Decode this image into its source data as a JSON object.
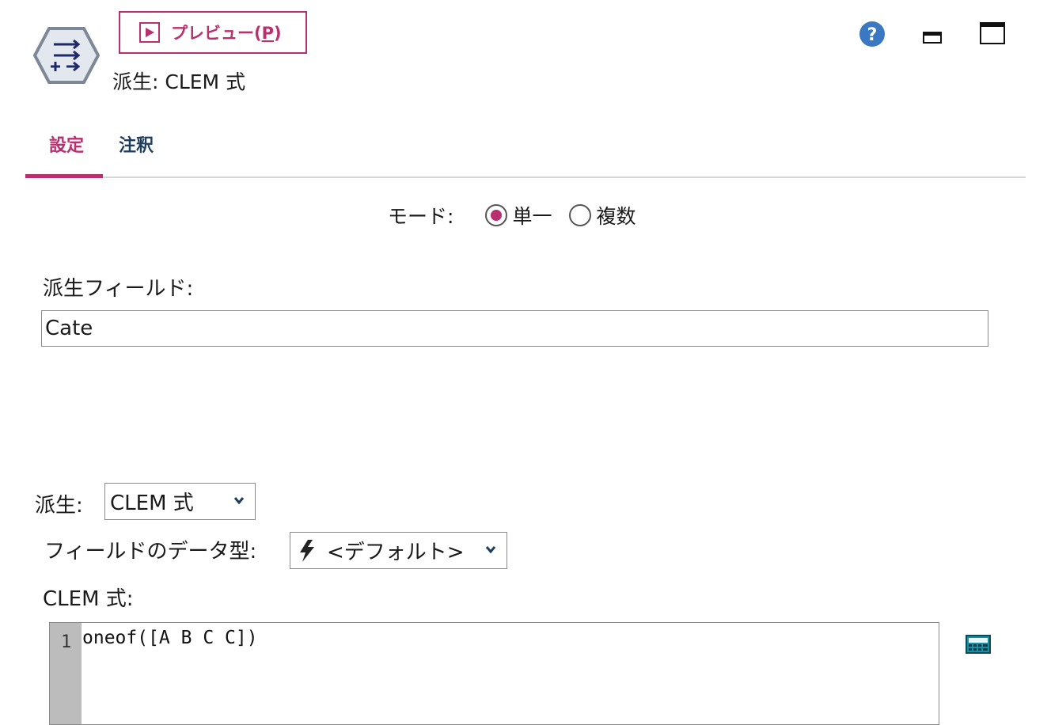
{
  "header": {
    "node_icon": "derive-node-icon",
    "preview_label": "プレビュー(",
    "preview_shortcut": "P",
    "preview_close": ")",
    "node_title": "派生: CLEM 式",
    "icons": [
      "help-icon",
      "minimize-icon",
      "maximize-icon"
    ]
  },
  "tabs": [
    {
      "label": "設定",
      "active": true
    },
    {
      "label": "注釈",
      "active": false
    }
  ],
  "mode": {
    "label": "モード:",
    "options": [
      {
        "label": "単一",
        "selected": true
      },
      {
        "label": "複数",
        "selected": false
      }
    ]
  },
  "derive_field": {
    "label": "派生フィールド:",
    "value": "Cate"
  },
  "derive_as": {
    "label": "派生:",
    "selected": "CLEM 式"
  },
  "field_type": {
    "label": "フィールドのデータ型:",
    "selected": "<デフォルト>",
    "icon": "lightning-icon"
  },
  "expression": {
    "label": "CLEM 式:",
    "line_number": "1",
    "code": "oneof([A B C C])",
    "calculator_icon": "expression-builder-icon"
  },
  "colors": {
    "accent": "#b8306e",
    "tab_inactive": "#1f3d5c",
    "help_blue": "#3a78c2"
  }
}
